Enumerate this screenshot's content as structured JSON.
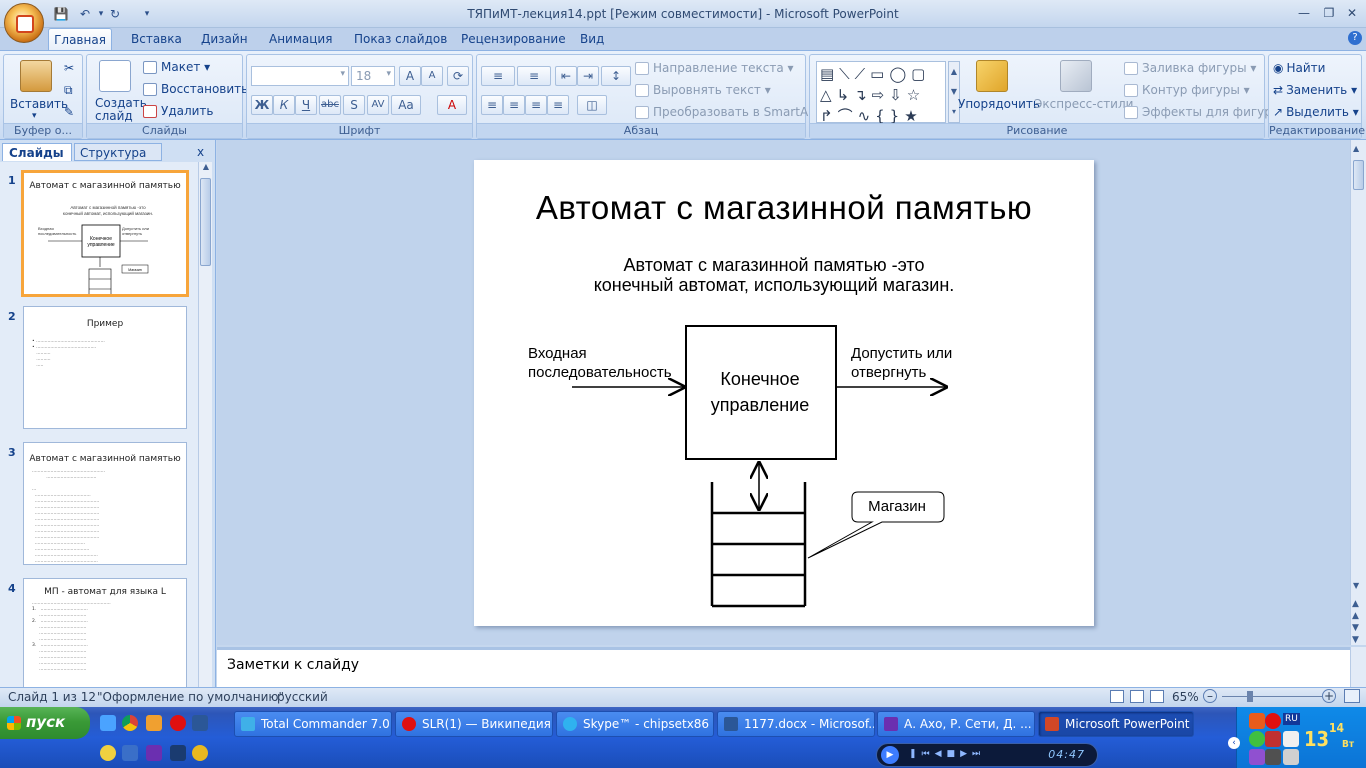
{
  "window": {
    "title": "ТЯПиМТ-лекция14.ppt [Режим совместимости] - Microsoft PowerPoint"
  },
  "tabs": [
    "Главная",
    "Вставка",
    "Дизайн",
    "Анимация",
    "Показ слайдов",
    "Рецензирование",
    "Вид"
  ],
  "ribbon": {
    "clipboard": {
      "paste": "Вставить",
      "label": "Буфер о..."
    },
    "slides": {
      "new_slide": "Создать слайд",
      "layout": "Макет",
      "reset": "Восстановить",
      "delete": "Удалить",
      "label": "Слайды"
    },
    "font": {
      "size": "18",
      "label": "Шрифт"
    },
    "paragraph": {
      "text_direction": "Направление текста",
      "align_text": "Выровнять текст",
      "smartart": "Преобразовать в SmartArt",
      "label": "Абзац"
    },
    "drawing": {
      "arrange": "Упорядочить",
      "quick_styles": "Экспресс-стили",
      "fill": "Заливка фигуры",
      "outline": "Контур фигуры",
      "effects": "Эффекты для фигур",
      "label": "Рисование"
    },
    "editing": {
      "find": "Найти",
      "replace": "Заменить",
      "select": "Выделить",
      "label": "Редактирование"
    }
  },
  "left_pane": {
    "tab_slides": "Слайды",
    "tab_outline": "Структура",
    "close": "x"
  },
  "thumbnails": [
    {
      "num": "1",
      "title": "Автомат с магазинной памятью"
    },
    {
      "num": "2",
      "title": "Пример"
    },
    {
      "num": "3",
      "title": "Автомат с магазинной памятью"
    },
    {
      "num": "4",
      "title": "МП - автомат для языка L"
    }
  ],
  "slide": {
    "title": "Автомат с магазинной памятью",
    "subtitle_line1": "Автомат с магазинной памятью -это",
    "subtitle_line2": "конечный автомат, использующий магазин.",
    "input_line1": "Входная",
    "input_line2": "последовательность",
    "output_line1": "Допустить или",
    "output_line2": "отвергнуть",
    "box_line1": "Конечное",
    "box_line2": "управление",
    "callout": "Магазин"
  },
  "notes": {
    "placeholder": "Заметки к слайду"
  },
  "status": {
    "slide_of": "Слайд 1 из 12",
    "theme": "\"Оформление по умолчанию\"",
    "language": "русский",
    "zoom": "65%"
  },
  "taskbar": {
    "start": "пуск",
    "tasks": [
      "Total Commander 7.0...",
      "SLR(1) — Википедия...",
      "Skype™ - chipsetx86",
      "1177.docx - Microsof...",
      "А. Ахо, Р. Сети, Д. ...",
      "Microsoft PowerPoint ..."
    ],
    "player_time": "04:47",
    "clock_h": "13",
    "clock_m": "14",
    "clock_day": "Вт",
    "lang": "RU"
  }
}
